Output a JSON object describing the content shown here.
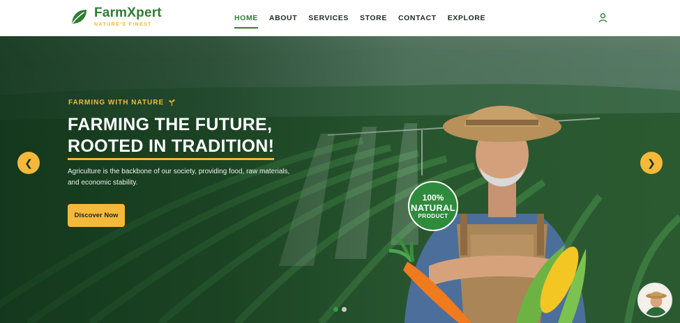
{
  "brand": {
    "name": "FarmXpert",
    "tagline": "NATURE'S FINEST"
  },
  "nav": {
    "items": [
      "HOME",
      "ABOUT",
      "SERVICES",
      "STORE",
      "CONTACT",
      "EXPLORE"
    ],
    "active": "HOME"
  },
  "icons": {
    "logo": "leaf-icon",
    "account": "user-icon",
    "eyebrow": "sprout-icon"
  },
  "hero": {
    "eyebrow": "FARMING WITH NATURE",
    "headline_line1": "FARMING THE FUTURE,",
    "headline_line2": "ROOTED IN TRADITION!",
    "description": "Agriculture is the backbone of our society, providing food, raw materials, and economic stability.",
    "cta_label": "Discover Now",
    "prev_arrow": "❮",
    "next_arrow": "❯",
    "slides_total": 2,
    "active_slide": 1
  },
  "badge": {
    "line1": "100%",
    "line2": "NATURAL",
    "line3": "PRODUCT"
  },
  "colors": {
    "brand_green": "#2e7d32",
    "accent_yellow": "#f4b93a",
    "badge_green": "#2e8b3c",
    "dot_inactive": "#c9c9c9"
  }
}
